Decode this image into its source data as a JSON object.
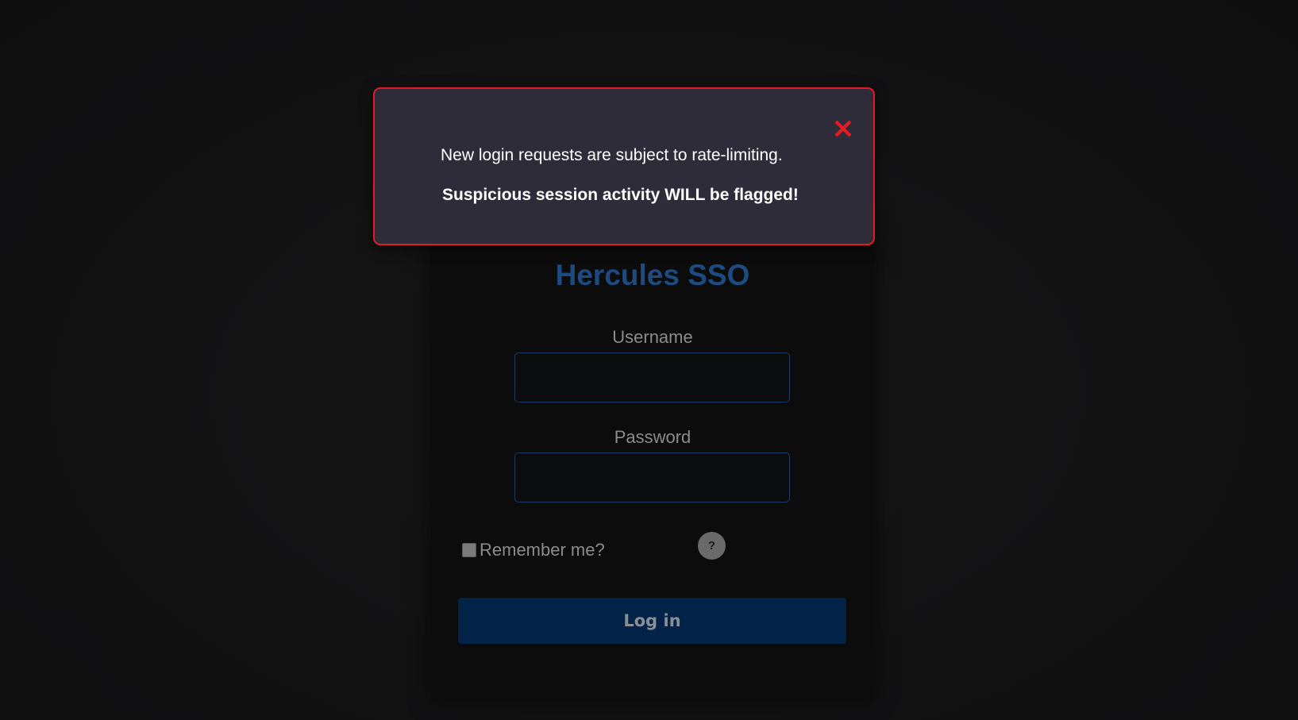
{
  "login": {
    "title": "Hercules SSO",
    "username_label": "Username",
    "username_value": "",
    "password_label": "Password",
    "password_value": "",
    "remember_label": "Remember me?",
    "remember_checked": false,
    "help_label": "?",
    "login_button": "Log in"
  },
  "modal": {
    "message": "New login requests are subject to rate-limiting.",
    "warning": "Suspicious session activity WILL be flagged!",
    "close_icon": "close-icon"
  },
  "colors": {
    "background": "#111112",
    "card": "#0c0c0d",
    "title": "#1d4a80",
    "input_border": "#1a3c66",
    "button": "#032348",
    "modal_background": "#2e2c38",
    "modal_border": "#e41b26",
    "close_icon": "#e41b26"
  }
}
